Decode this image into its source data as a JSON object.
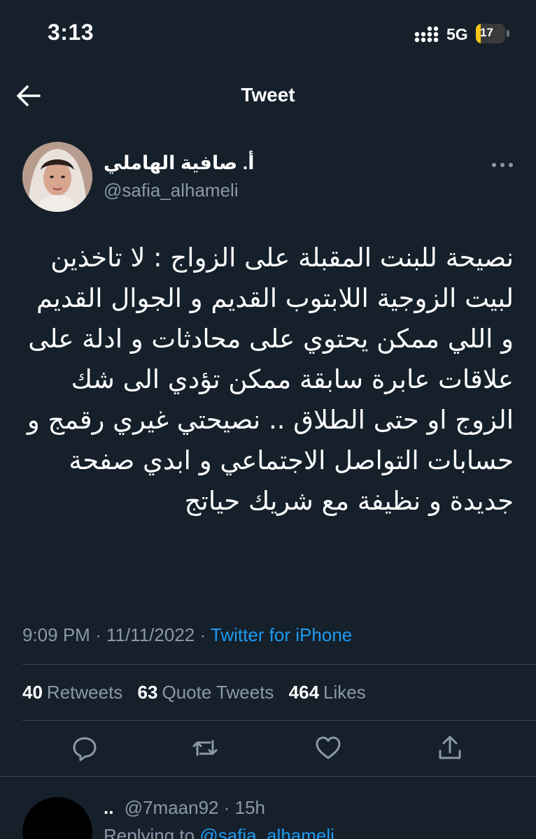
{
  "status_bar": {
    "time": "3:13",
    "network": "5G",
    "battery": "17",
    "battery_level": 0.17,
    "icons": [
      "signal-dots-icon",
      "battery-charging-icon"
    ]
  },
  "nav": {
    "title": "Tweet",
    "back_icon": "arrow-left-icon"
  },
  "tweet": {
    "display_name": "أ. صافية الهاملي",
    "handle": "@safia_alhameli",
    "more_icon": "ellipsis-icon",
    "text": "نصيحة للبنت المقبلة على الزواج : لا تاخذين لبيت الزوجية اللابتوب القديم و الجوال القديم و اللي ممكن يحتوي على محادثات و ادلة على علاقات عابرة سابقة ممكن تؤدي الى شك الزوج او حتى الطلاق .. نصيحتي غيري رقمج و حسابات التواصل الاجتماعي و ابدي صفحة جديدة و نظيفة مع شريك حياتج",
    "time": "9:09 PM",
    "date": "11/11/2022",
    "separator": "·",
    "source": "Twitter for iPhone"
  },
  "stats": {
    "retweets_count": "40",
    "retweets_label": "Retweets",
    "quotes_count": "63",
    "quotes_label": "Quote Tweets",
    "likes_count": "464",
    "likes_label": "Likes"
  },
  "actions": {
    "icons": [
      "reply-icon",
      "retweet-icon",
      "like-icon",
      "share-icon"
    ]
  },
  "reply": {
    "name": "..",
    "handle": "@7maan92",
    "separator": "·",
    "age": "15h",
    "replying_prefix": "Replying to",
    "replying_to": "@safia_alhameli"
  },
  "colors": {
    "background": "#15202b",
    "text": "#ffffff",
    "secondary": "#8b98a5",
    "accent": "#1d9bf0",
    "divider": "#38444d",
    "battery": "#f5c518"
  }
}
